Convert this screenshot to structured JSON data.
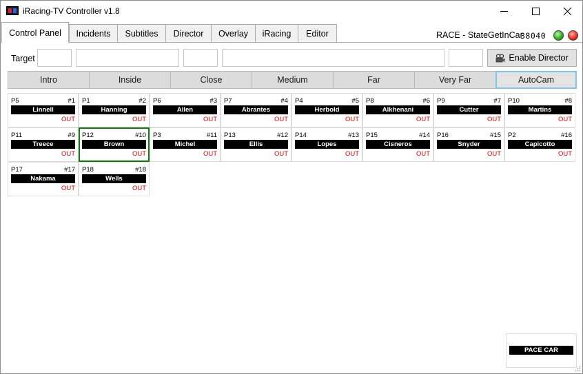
{
  "window": {
    "title": "iRacing-TV Controller v1.8",
    "icon": "app-logo-icon"
  },
  "tabs": [
    {
      "label": "Control Panel",
      "active": true
    },
    {
      "label": "Incidents",
      "active": false
    },
    {
      "label": "Subtitles",
      "active": false
    },
    {
      "label": "Director",
      "active": false
    },
    {
      "label": "Overlay",
      "active": false
    },
    {
      "label": "iRacing",
      "active": false
    },
    {
      "label": "Editor",
      "active": false
    }
  ],
  "status": {
    "session_state": "RACE - StateGetInCar",
    "code": "38040",
    "indicator_colors": {
      "connected": "#2fa51a",
      "live": "#e5271b"
    }
  },
  "target": {
    "label": "Target",
    "fields": [
      "",
      "",
      "",
      "",
      ""
    ]
  },
  "enable_director": {
    "label": "Enable Director",
    "icon": "camera-icon"
  },
  "cameras": [
    {
      "label": "Intro",
      "selected": false
    },
    {
      "label": "Inside",
      "selected": false
    },
    {
      "label": "Close",
      "selected": false
    },
    {
      "label": "Medium",
      "selected": false
    },
    {
      "label": "Far",
      "selected": false
    },
    {
      "label": "Very Far",
      "selected": false
    },
    {
      "label": "AutoCam",
      "selected": true
    }
  ],
  "drivers": [
    {
      "pos": "P5",
      "num": "#1",
      "name": "Linnell",
      "state": "OUT"
    },
    {
      "pos": "P1",
      "num": "#2",
      "name": "Hanning",
      "state": "OUT"
    },
    {
      "pos": "P6",
      "num": "#3",
      "name": "Allen",
      "state": "OUT"
    },
    {
      "pos": "P7",
      "num": "#4",
      "name": "Abrantes",
      "state": "OUT"
    },
    {
      "pos": "P4",
      "num": "#5",
      "name": "Herbold",
      "state": "OUT"
    },
    {
      "pos": "P8",
      "num": "#6",
      "name": "Alkhenani",
      "state": "OUT"
    },
    {
      "pos": "P9",
      "num": "#7",
      "name": "Cutter",
      "state": "OUT"
    },
    {
      "pos": "P10",
      "num": "#8",
      "name": "Martins",
      "state": "OUT"
    },
    {
      "pos": "P11",
      "num": "#9",
      "name": "Treece",
      "state": "OUT"
    },
    {
      "pos": "P12",
      "num": "#10",
      "name": "Brown",
      "state": "OUT",
      "selected": true
    },
    {
      "pos": "P3",
      "num": "#11",
      "name": "Michel",
      "state": "OUT"
    },
    {
      "pos": "P13",
      "num": "#12",
      "name": "Ellis",
      "state": "OUT"
    },
    {
      "pos": "P14",
      "num": "#13",
      "name": "Lopes",
      "state": "OUT"
    },
    {
      "pos": "P15",
      "num": "#14",
      "name": "Cisneros",
      "state": "OUT"
    },
    {
      "pos": "P16",
      "num": "#15",
      "name": "Snyder",
      "state": "OUT"
    },
    {
      "pos": "P2",
      "num": "#16",
      "name": "Capicotto",
      "state": "OUT"
    },
    {
      "pos": "P17",
      "num": "#17",
      "name": "Nakama",
      "state": "OUT"
    },
    {
      "pos": "P18",
      "num": "#18",
      "name": "Wells",
      "state": "OUT"
    }
  ],
  "pace_car": {
    "name": "PACE CAR"
  },
  "colors": {
    "accent_selected_camera": "#82c4e9",
    "selected_driver_border": "#137a13",
    "out_state": "#e00000"
  }
}
